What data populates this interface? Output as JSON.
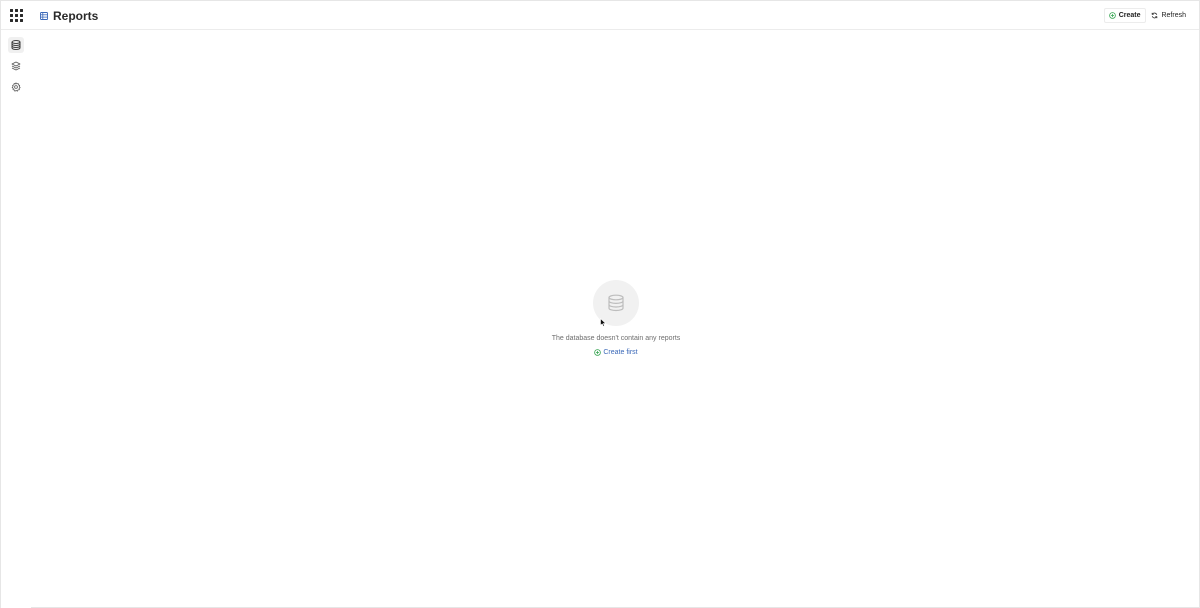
{
  "header": {
    "title": "Reports",
    "title_icon": "table-icon",
    "apps_icon": "grid-icon",
    "actions": {
      "create_label": "Create",
      "create_icon": "plus-circle-icon",
      "refresh_label": "Refresh",
      "refresh_icon": "refresh-icon"
    }
  },
  "sidebar": {
    "items": [
      {
        "icon": "database-icon",
        "active": true
      },
      {
        "icon": "layers-icon",
        "active": false
      },
      {
        "icon": "gear-icon",
        "active": false
      }
    ]
  },
  "empty_state": {
    "icon": "database-icon",
    "message": "The database doesn't contain any reports",
    "action_label": "Create first",
    "action_icon": "plus-circle-icon"
  },
  "colors": {
    "accent_green": "#3aa655",
    "link_blue": "#3a68b8",
    "title_icon_blue": "#3a68b8"
  }
}
